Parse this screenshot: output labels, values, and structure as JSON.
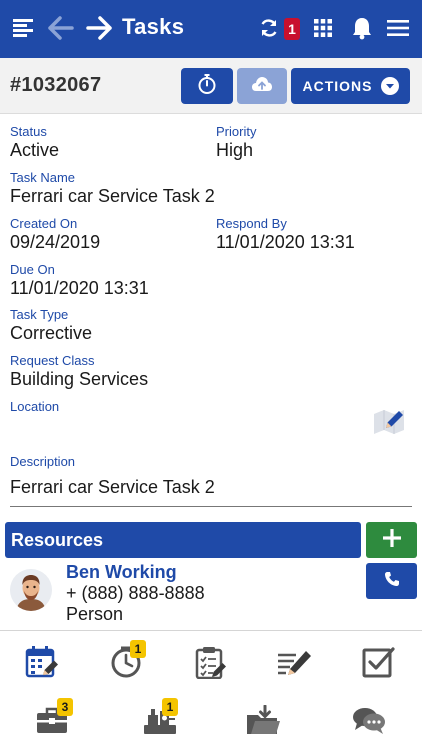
{
  "header": {
    "title": "Tasks",
    "sync_count": "1"
  },
  "task": {
    "id": "#1032067",
    "actions_label": "ACTIONS"
  },
  "fields": {
    "status_label": "Status",
    "status_value": "Active",
    "priority_label": "Priority",
    "priority_value": "High",
    "task_name_label": "Task Name",
    "task_name_value": "Ferrari car Service Task 2",
    "created_on_label": "Created On",
    "created_on_value": "09/24/2019",
    "respond_by_label": "Respond By",
    "respond_by_value": "11/01/2020 13:31",
    "due_on_label": "Due On",
    "due_on_value": "11/01/2020 13:31",
    "task_type_label": "Task Type",
    "task_type_value": "Corrective",
    "request_class_label": "Request Class",
    "request_class_value": "Building Services",
    "location_label": "Location",
    "description_label": "Description",
    "description_value": "Ferrari car Service Task 2"
  },
  "resources": {
    "title": "Resources",
    "person": {
      "name": "Ben Working",
      "phone": "+ (888) 888-8888",
      "type": "Person"
    }
  },
  "toolbar": {
    "badges": {
      "timer": "1",
      "toolbox": "3",
      "equipment": "1"
    }
  },
  "colors": {
    "primary": "#1f4aa8",
    "add_green": "#2e8b3e",
    "badge_red": "#c8102e",
    "badge_yellow": "#f4c400"
  }
}
